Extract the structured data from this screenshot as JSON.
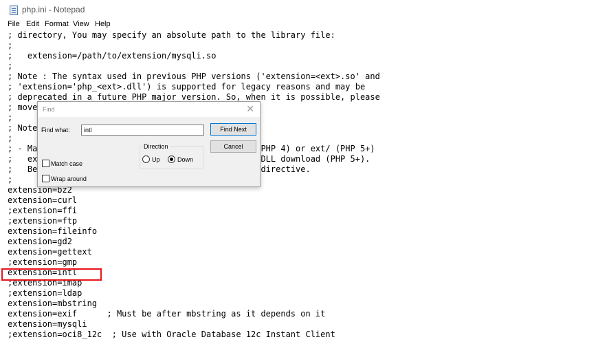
{
  "window": {
    "title": "php.ini - Notepad",
    "app_icon": "notepad-icon"
  },
  "menu": [
    "File",
    "Edit",
    "Format",
    "View",
    "Help"
  ],
  "editor": {
    "lines": [
      "; directory, You may specify an absolute path to the library file:",
      ";",
      ";   extension=/path/to/extension/mysqli.so",
      ";",
      "; Note : The syntax used in previous PHP versions ('extension=<ext>.so' and",
      "; 'extension='php_<ext>.dll') is supported for legacy reasons and may be",
      "; deprecated in a future PHP major version. So, when it is possible, please",
      "; move to the new ('extension=<ext>) syntax.",
      ";",
      "; Notes for Windows environments :",
      ";",
      "; - Many DLL files are located in the extensions/ (PHP 4) or ext/ (PHP 5+)",
      ";   extension folders as well as the separate PECL DLL download (PHP 5+).",
      ";   Be sure to appropriately set the extension_dir directive.",
      ";",
      "extension=bz2",
      "extension=curl",
      ";extension=ffi",
      ";extension=ftp",
      "extension=fileinfo",
      "extension=gd2",
      "extension=gettext",
      ";extension=gmp",
      "extension=intl",
      ";extension=imap",
      ";extension=ldap",
      "extension=mbstring",
      "extension=exif      ; Must be after mbstring as it depends on it",
      "extension=mysqli",
      ";extension=oci8_12c  ; Use with Oracle Database 12c Instant Client"
    ]
  },
  "find_dialog": {
    "title": "Find",
    "find_what_label": "Find what:",
    "find_what_value": "intl",
    "find_next_label": "Find Next",
    "cancel_label": "Cancel",
    "direction_label": "Direction",
    "up_label": "Up",
    "down_label": "Down",
    "direction_selected": "Down",
    "match_case_label": "Match case",
    "match_case_checked": false,
    "wrap_around_label": "Wrap around",
    "wrap_around_checked": false,
    "close_icon": "close-icon"
  },
  "colors": {
    "highlight_box": "#e8141a",
    "default_button_border": "#0078d7"
  }
}
